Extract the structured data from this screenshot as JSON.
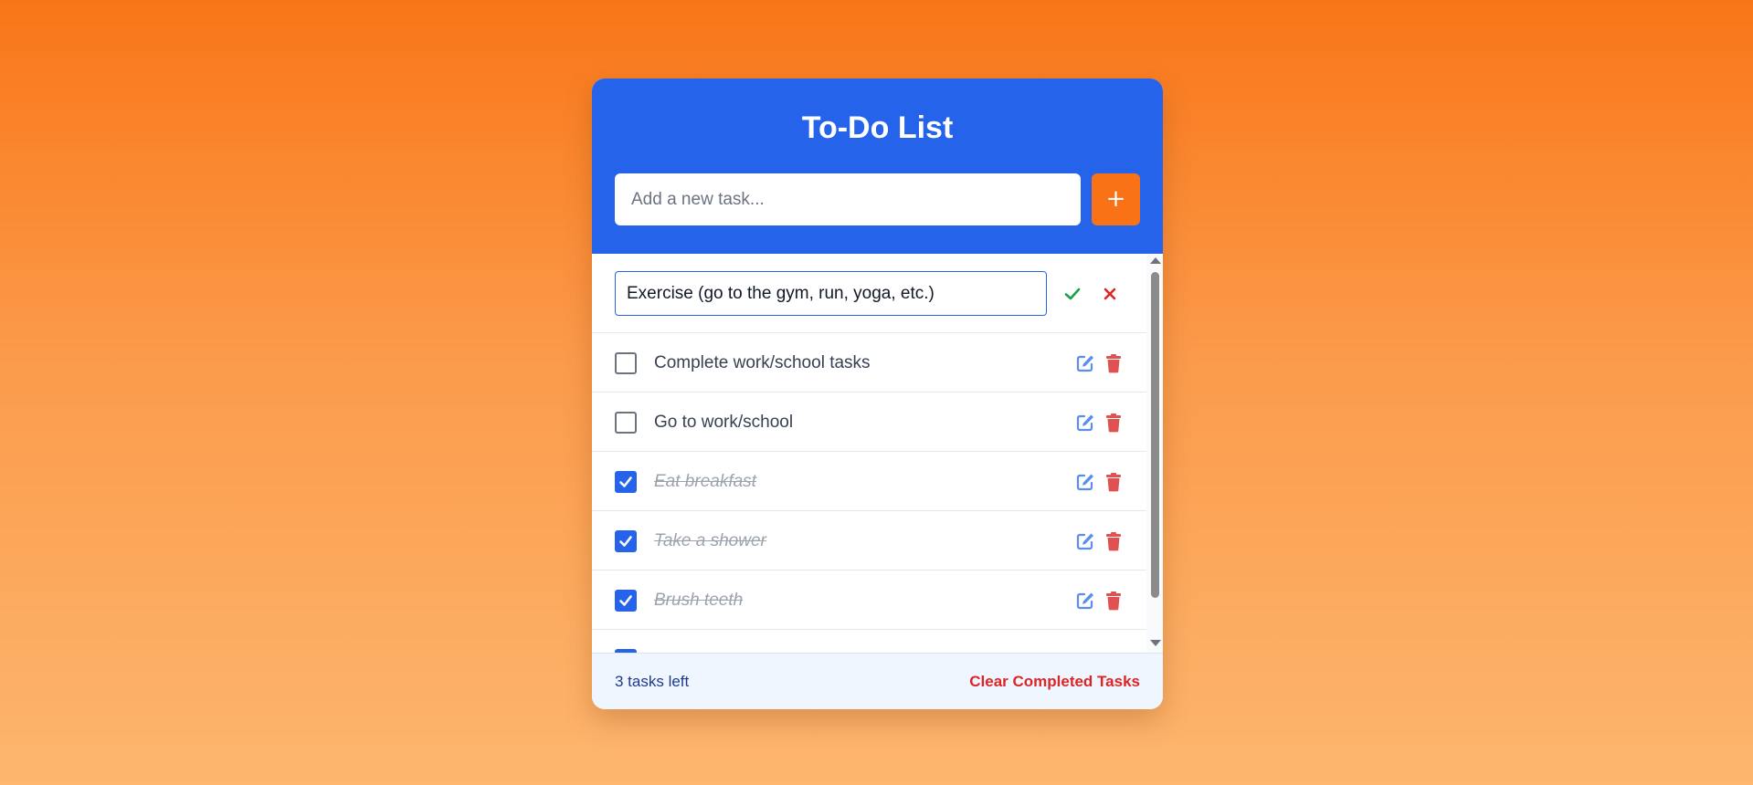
{
  "app": {
    "title": "To-Do List"
  },
  "new_task": {
    "placeholder": "Add a new task...",
    "value": "",
    "add_label": "+"
  },
  "editing": {
    "value": "Exercise (go to the gym, run, yoga, etc.)",
    "save_icon": "check-icon",
    "cancel_icon": "close-icon"
  },
  "tasks": [
    {
      "text": "Complete work/school tasks",
      "completed": false
    },
    {
      "text": "Go to work/school",
      "completed": false
    },
    {
      "text": "Eat breakfast",
      "completed": true
    },
    {
      "text": "Take a shower",
      "completed": true
    },
    {
      "text": "Brush teeth",
      "completed": true
    }
  ],
  "footer": {
    "tasks_left": "3 tasks left",
    "clear_label": "Clear Completed Tasks"
  },
  "colors": {
    "primary": "#2563eb",
    "accent": "#f97316",
    "danger": "#dc2626",
    "success": "#16a34a"
  }
}
